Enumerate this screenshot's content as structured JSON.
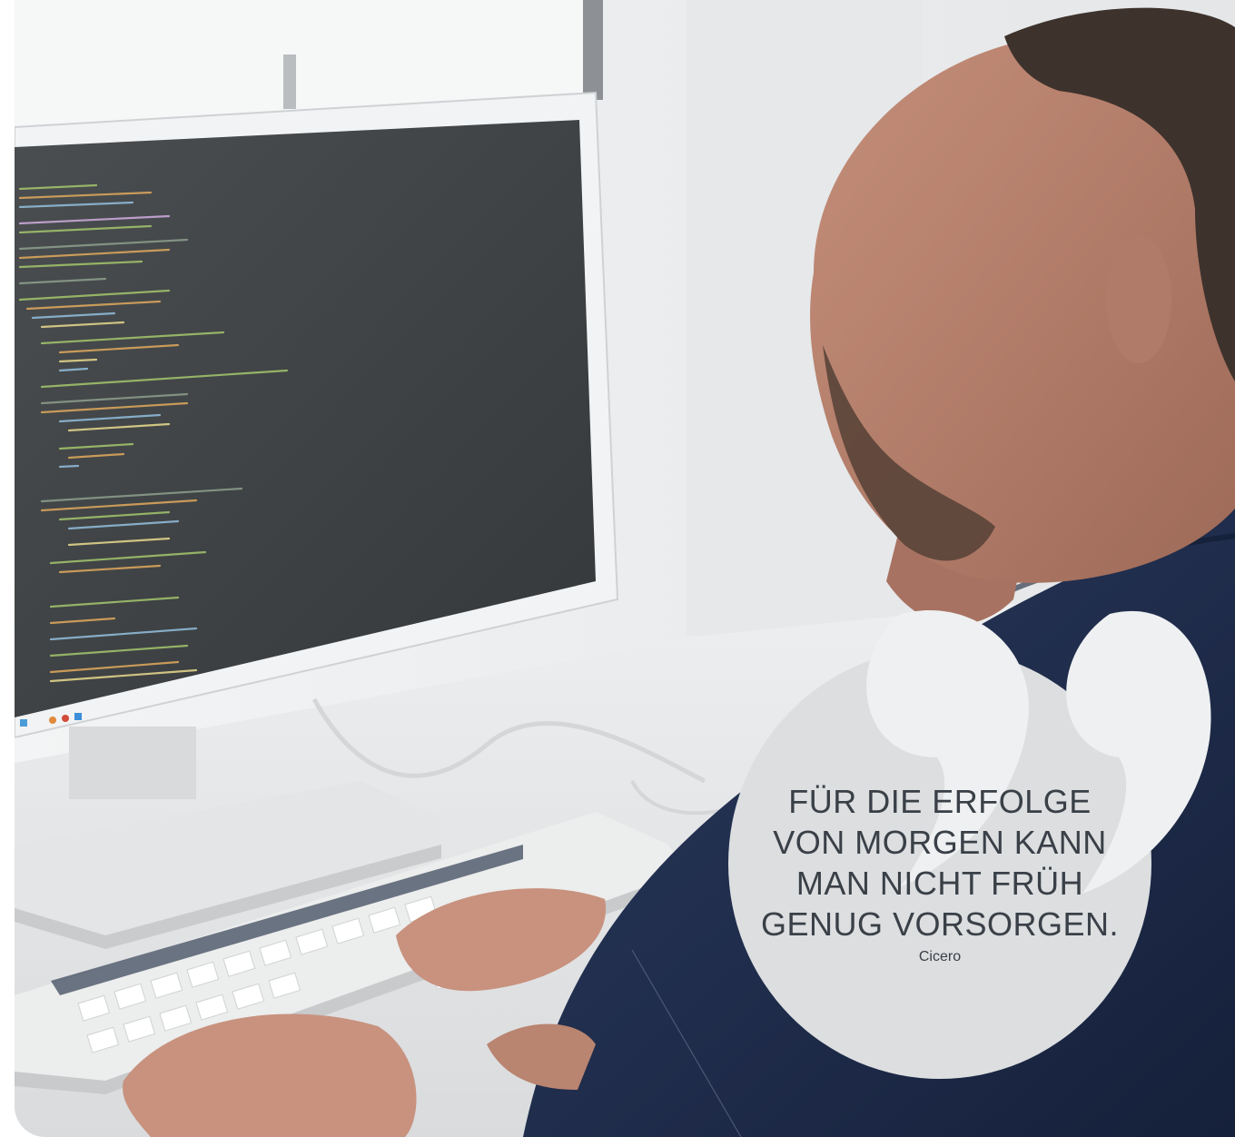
{
  "quote": {
    "lines": [
      "FÜR DIE ERFOLGE",
      "VON MORGEN KANN",
      "MAN NICHT FRÜH",
      "GENUG VORSORGEN."
    ],
    "author": "Cicero"
  },
  "icons": [
    "quotation-marks-icon"
  ],
  "colors": {
    "bubble": "#dcdee0",
    "quote_marks": "#eef0f2",
    "text": "#3a4047",
    "shirt": "#1e2b4a",
    "monitor_screen": "#3d4144"
  }
}
